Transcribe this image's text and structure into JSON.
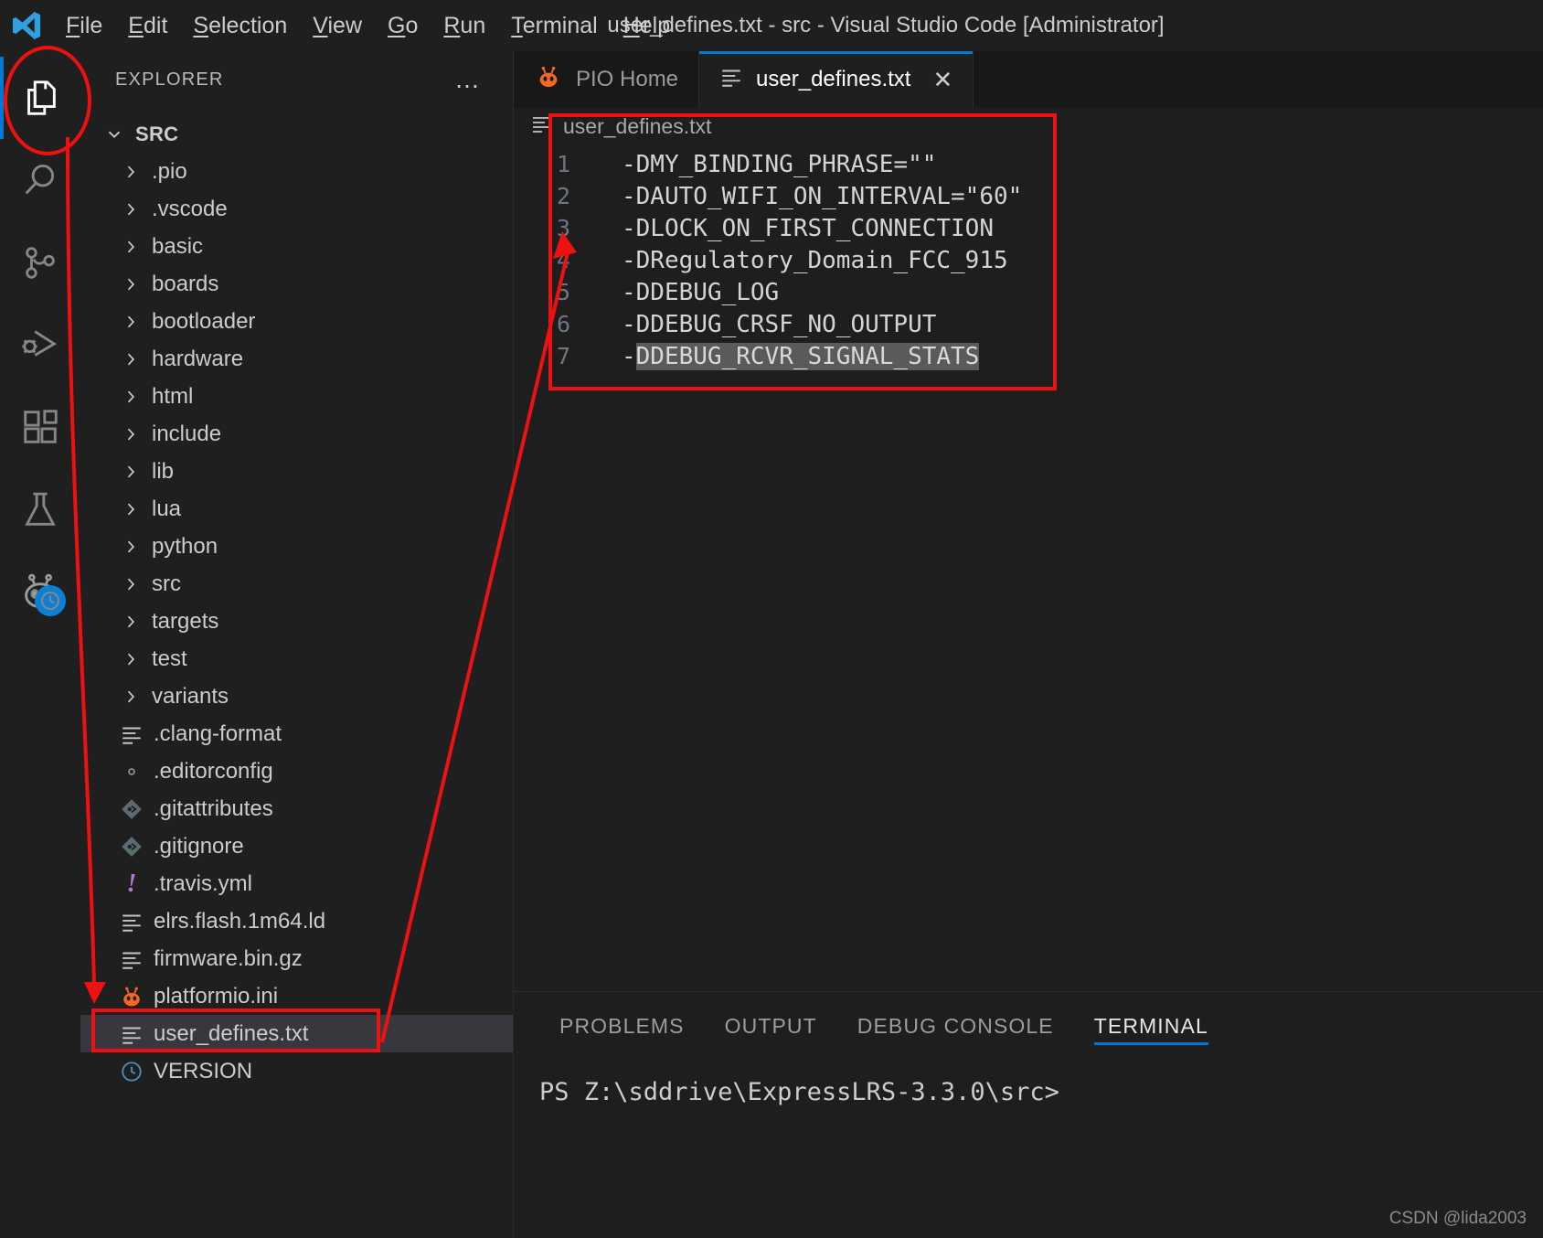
{
  "titlebar": {
    "window_title": "user_defines.txt - src - Visual Studio Code [Administrator]",
    "logo_icon": "vscode-logo-icon",
    "menus": [
      {
        "label": "File",
        "mnemonic": "F",
        "rest": "ile"
      },
      {
        "label": "Edit",
        "mnemonic": "E",
        "rest": "dit"
      },
      {
        "label": "Selection",
        "mnemonic": "S",
        "rest": "election"
      },
      {
        "label": "View",
        "mnemonic": "V",
        "rest": "iew"
      },
      {
        "label": "Go",
        "mnemonic": "G",
        "rest": "o"
      },
      {
        "label": "Run",
        "mnemonic": "R",
        "rest": "un"
      },
      {
        "label": "Terminal",
        "mnemonic": "T",
        "rest": "erminal"
      },
      {
        "label": "Help",
        "mnemonic": "H",
        "rest": "elp"
      }
    ]
  },
  "activitybar": {
    "items": [
      {
        "name": "explorer",
        "icon": "files-icon",
        "active": true
      },
      {
        "name": "search",
        "icon": "search-icon",
        "active": false
      },
      {
        "name": "source-control",
        "icon": "source-control-icon",
        "active": false
      },
      {
        "name": "run-and-debug",
        "icon": "run-debug-icon",
        "active": false
      },
      {
        "name": "extensions",
        "icon": "extensions-icon",
        "active": false
      },
      {
        "name": "testing",
        "icon": "beaker-icon",
        "active": false
      },
      {
        "name": "platformio",
        "icon": "platformio-alien-icon",
        "active": false,
        "badge": "clock-badge-icon"
      }
    ]
  },
  "sidebar": {
    "title": "EXPLORER",
    "more_actions": "…",
    "root": {
      "label": "SRC",
      "expanded": true,
      "chevron": "chevron-down-icon"
    },
    "tree": [
      {
        "label": ".pio",
        "type": "folder",
        "icon": "chevron-right-icon"
      },
      {
        "label": ".vscode",
        "type": "folder",
        "icon": "chevron-right-icon"
      },
      {
        "label": "basic",
        "type": "folder",
        "icon": "chevron-right-icon"
      },
      {
        "label": "boards",
        "type": "folder",
        "icon": "chevron-right-icon"
      },
      {
        "label": "bootloader",
        "type": "folder",
        "icon": "chevron-right-icon"
      },
      {
        "label": "hardware",
        "type": "folder",
        "icon": "chevron-right-icon"
      },
      {
        "label": "html",
        "type": "folder",
        "icon": "chevron-right-icon"
      },
      {
        "label": "include",
        "type": "folder",
        "icon": "chevron-right-icon"
      },
      {
        "label": "lib",
        "type": "folder",
        "icon": "chevron-right-icon"
      },
      {
        "label": "lua",
        "type": "folder",
        "icon": "chevron-right-icon"
      },
      {
        "label": "python",
        "type": "folder",
        "icon": "chevron-right-icon"
      },
      {
        "label": "src",
        "type": "folder",
        "icon": "chevron-right-icon"
      },
      {
        "label": "targets",
        "type": "folder",
        "icon": "chevron-right-icon"
      },
      {
        "label": "test",
        "type": "folder",
        "icon": "chevron-right-icon"
      },
      {
        "label": "variants",
        "type": "folder",
        "icon": "chevron-right-icon"
      },
      {
        "label": ".clang-format",
        "type": "file",
        "icon": "text-file-icon"
      },
      {
        "label": ".editorconfig",
        "type": "file",
        "icon": "gear-icon"
      },
      {
        "label": ".gitattributes",
        "type": "file",
        "icon": "git-icon"
      },
      {
        "label": ".gitignore",
        "type": "file",
        "icon": "git-icon"
      },
      {
        "label": ".travis.yml",
        "type": "file",
        "icon": "exclamation-icon"
      },
      {
        "label": "elrs.flash.1m64.ld",
        "type": "file",
        "icon": "text-file-icon"
      },
      {
        "label": "firmware.bin.gz",
        "type": "file",
        "icon": "text-file-icon"
      },
      {
        "label": "platformio.ini",
        "type": "file",
        "icon": "platformio-alien-icon"
      },
      {
        "label": "user_defines.txt",
        "type": "file",
        "icon": "text-file-icon",
        "selected": true
      },
      {
        "label": "VERSION",
        "type": "file",
        "icon": "clock-icon"
      }
    ]
  },
  "editor": {
    "tabs": [
      {
        "label": "PIO Home",
        "icon": "platformio-alien-icon",
        "active": false,
        "closable": false
      },
      {
        "label": "user_defines.txt",
        "icon": "text-file-icon",
        "active": true,
        "closable": true,
        "close_glyph": "✕"
      }
    ],
    "breadcrumb": {
      "icon": "text-file-icon",
      "label": "user_defines.txt"
    },
    "lines": [
      {
        "num": "1",
        "text": "-DMY_BINDING_PHRASE=\"\"",
        "selected": false
      },
      {
        "num": "2",
        "text": "-DAUTO_WIFI_ON_INTERVAL=\"60\"",
        "selected": false
      },
      {
        "num": "3",
        "text": "-DLOCK_ON_FIRST_CONNECTION",
        "selected": false
      },
      {
        "num": "4",
        "text": "-DRegulatory_Domain_FCC_915",
        "selected": false
      },
      {
        "num": "5",
        "text": "-DDEBUG_LOG",
        "selected": false
      },
      {
        "num": "6",
        "text": "-DDEBUG_CRSF_NO_OUTPUT",
        "selected": false
      },
      {
        "num": "7",
        "prefix": "-",
        "text": "DDEBUG_RCVR_SIGNAL_STATS",
        "selected": true
      }
    ]
  },
  "panel": {
    "tabs": [
      {
        "label": "PROBLEMS",
        "active": false
      },
      {
        "label": "OUTPUT",
        "active": false
      },
      {
        "label": "DEBUG CONSOLE",
        "active": false
      },
      {
        "label": "TERMINAL",
        "active": true
      }
    ],
    "terminal_prompt": "PS Z:\\sddrive\\ExpressLRS-3.3.0\\src>"
  },
  "watermark": "CSDN @lida2003",
  "annotations": {
    "color": "#ee1111",
    "shapes": [
      "ellipse-around-explorer-icon",
      "rect-around-code-block",
      "rect-around-user-defines-file",
      "arrow-sidebar-to-activitybar",
      "arrow-file-to-code"
    ]
  },
  "colors": {
    "accent": "#0078d4",
    "bg": "#1e1e1e",
    "sidebar_bg": "#1f1f1f",
    "selection": "#37373d",
    "annotation_red": "#ee1111",
    "platformio_orange": "#f26722"
  }
}
